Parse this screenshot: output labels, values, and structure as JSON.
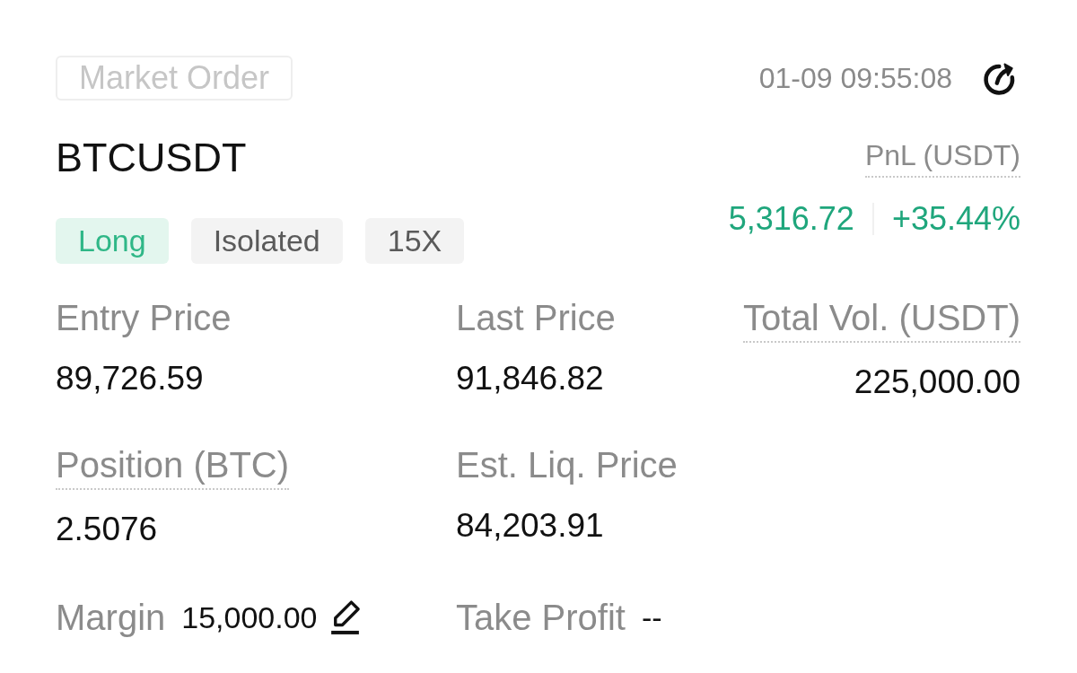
{
  "order_type": "Market Order",
  "timestamp": "01-09 09:55:08",
  "symbol": "BTCUSDT",
  "tags": [
    {
      "label": "Long",
      "kind": "long"
    },
    {
      "label": "Isolated",
      "kind": "neutral"
    },
    {
      "label": "15X",
      "kind": "neutral"
    }
  ],
  "pnl": {
    "label": "PnL (USDT)",
    "dotted": true,
    "amount": "5,316.72",
    "percent": "+35.44%"
  },
  "details": [
    [
      {
        "kind": "stacked",
        "label": "Entry Price",
        "value": "89,726.59",
        "dotted": false
      },
      {
        "kind": "stacked",
        "label": "Last Price",
        "value": "91,846.82",
        "dotted": false
      },
      {
        "kind": "stacked",
        "label": "Total Vol. (USDT)",
        "value": "225,000.00",
        "dotted": true
      }
    ],
    [
      {
        "kind": "stacked",
        "label": "Position (BTC)",
        "value": "2.5076",
        "dotted": true
      },
      {
        "kind": "stacked",
        "label": "Est. Liq. Price",
        "value": "84,203.91",
        "dotted": false
      }
    ],
    [
      {
        "kind": "inline",
        "label": "Margin",
        "value": "15,000.00",
        "editable": true
      },
      {
        "kind": "inline",
        "label": "Take Profit",
        "value": "--",
        "editable": false
      }
    ]
  ]
}
